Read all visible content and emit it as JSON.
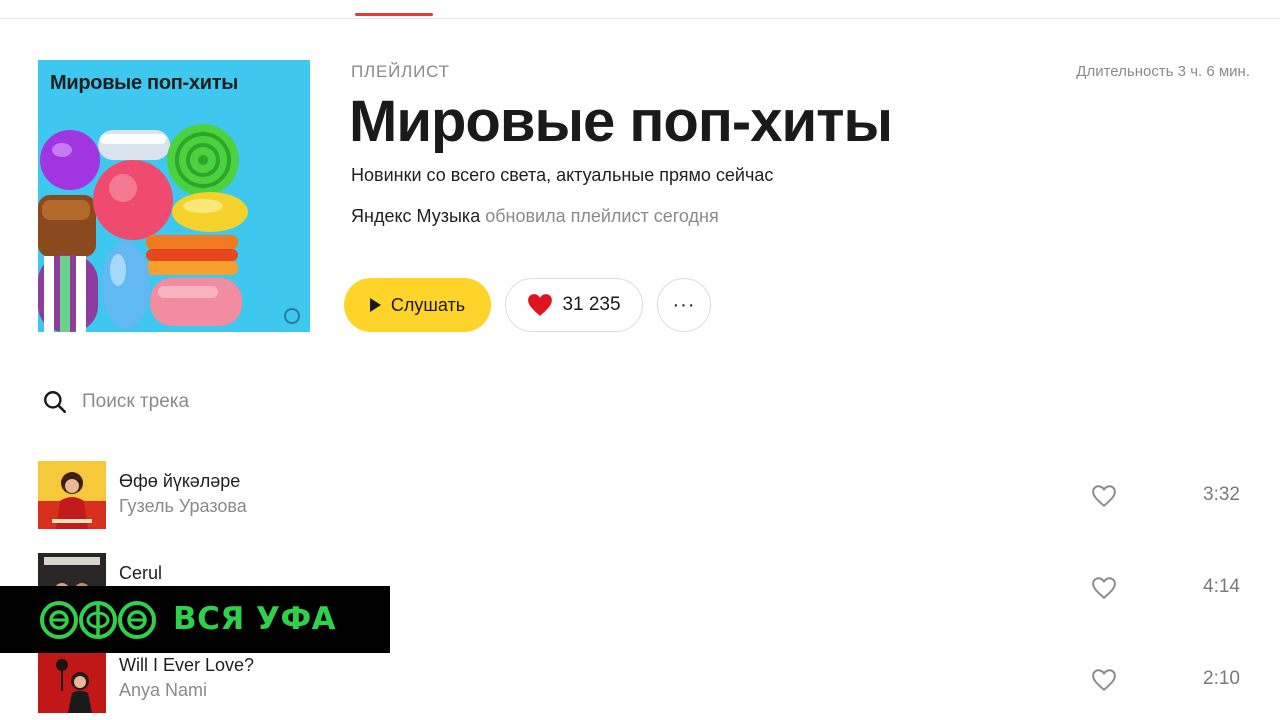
{
  "playlist": {
    "kind": "ПЛЕЙЛИСТ",
    "title": "Мировые поп-хиты",
    "description": "Новинки со всего света, актуальные прямо сейчас",
    "author": "Яндекс Музыка",
    "updated": " обновила плейлист сегодня",
    "duration": "Длительность 3 ч. 6 мин.",
    "cover_title": "Мировые поп-хиты"
  },
  "actions": {
    "play_label": "Слушать",
    "likes": "31 235",
    "more_label": "···"
  },
  "search": {
    "placeholder": "Поиск трека"
  },
  "tracks": [
    {
      "title": "Өфө йүкәләре",
      "artist": "Гузель Уразова",
      "duration": "3:32"
    },
    {
      "title": "Cerul",
      "artist": "",
      "duration": "4:14"
    },
    {
      "title": "Will I Ever Love?",
      "artist": "Anya Nami",
      "duration": "2:10"
    }
  ],
  "watermark": {
    "logo_letters": "өфө",
    "text": "ВСЯ УФА"
  },
  "colors": {
    "accent_yellow": "#fed42b",
    "heart_red": "#e0141e",
    "tab_underline": "#e53935",
    "cover_bg": "#3ec7ef",
    "watermark_green": "#2fd14a"
  }
}
